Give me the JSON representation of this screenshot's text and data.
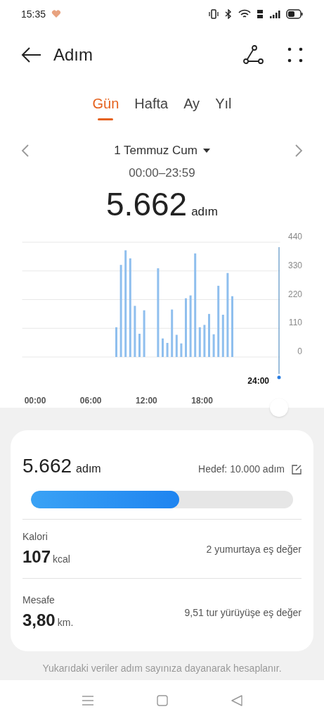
{
  "status_bar": {
    "time": "15:35"
  },
  "header": {
    "title": "Adım"
  },
  "tabs": [
    {
      "label": "Gün",
      "selected": true
    },
    {
      "label": "Hafta",
      "selected": false
    },
    {
      "label": "Ay",
      "selected": false
    },
    {
      "label": "Yıl",
      "selected": false
    }
  ],
  "date": {
    "label": "1 Temmuz Cum",
    "range": "00:00–23:59"
  },
  "total": {
    "value": "5.662",
    "unit": "adım"
  },
  "chart": {
    "cursor_label": "24:00",
    "chart_data": {
      "type": "bar",
      "x": [
        8.75,
        9.25,
        9.75,
        10.25,
        10.75,
        11.25,
        11.75,
        13.25,
        13.75,
        14.25,
        14.75,
        15.25,
        15.75,
        16.25,
        16.75,
        17.25,
        17.75,
        18.25,
        18.75,
        19.25,
        19.75,
        20.25,
        20.75,
        21.25
      ],
      "values": [
        114,
        353,
        409,
        378,
        196,
        89,
        179,
        340,
        71,
        54,
        182,
        85,
        52,
        225,
        236,
        397,
        114,
        123,
        165,
        87,
        273,
        162,
        322,
        233
      ],
      "xlim": [
        -1.4,
        26.4
      ],
      "ylim": [
        0,
        440
      ],
      "grid": true,
      "xticks": [
        {
          "value": 0,
          "label": "00:00"
        },
        {
          "value": 6,
          "label": "06:00"
        },
        {
          "value": 12,
          "label": "12:00"
        },
        {
          "value": 18,
          "label": "18:00"
        }
      ],
      "yticks": [
        {
          "value": 0,
          "label": "0"
        },
        {
          "value": 110,
          "label": "110"
        },
        {
          "value": 220,
          "label": "220"
        },
        {
          "value": 330,
          "label": "330"
        },
        {
          "value": 440,
          "label": "440"
        }
      ]
    }
  },
  "summary": {
    "value": "5.662",
    "unit": "adım",
    "goal": "Hedef: 10.000 adım",
    "level": 0.566
  },
  "metrics": [
    {
      "label": "Kalori",
      "value": "107",
      "unit": "kcal",
      "note": "2 yumurtaya eş değer"
    },
    {
      "label": "Mesafe",
      "value": "3,80",
      "unit": "km.",
      "note": "9,51 tur yürüyüşe eş değer"
    }
  ],
  "footnote": "Yukarıdaki veriler adım sayınıza dayanarak hesaplanır."
}
